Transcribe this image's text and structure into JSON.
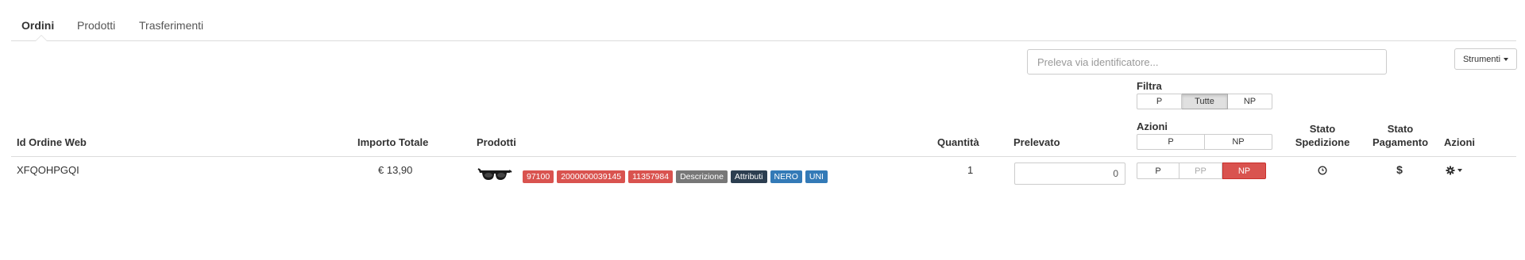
{
  "tabs": [
    {
      "label": "Ordini",
      "active": true
    },
    {
      "label": "Prodotti",
      "active": false
    },
    {
      "label": "Trasferimenti",
      "active": false
    }
  ],
  "search": {
    "placeholder": "Preleva via identificatore..."
  },
  "tools": {
    "label": "Strumenti"
  },
  "filter": {
    "label": "Filtra",
    "options": [
      "P",
      "Tutte",
      "NP"
    ],
    "selected": "Tutte"
  },
  "bulk_actions": {
    "label": "Azioni",
    "options": [
      "P",
      "NP"
    ]
  },
  "columns": {
    "order_id": "Id Ordine Web",
    "total": "Importo Totale",
    "products": "Prodotti",
    "quantity": "Quantità",
    "picked": "Prelevato",
    "actions": "Azioni",
    "shipping_status": [
      "Stato",
      "Spedizione"
    ],
    "payment_status": [
      "Stato",
      "Pagamento"
    ],
    "row_actions": "Azioni"
  },
  "rows": [
    {
      "order_id": "XFQOHPGQI",
      "total": "€ 13,90",
      "product_image": "sunglasses",
      "tags": [
        {
          "text": "97100",
          "color": "#d9534f"
        },
        {
          "text": "2000000039145",
          "color": "#d9534f"
        },
        {
          "text": "11357984",
          "color": "#d9534f"
        },
        {
          "text": "Descrizione",
          "color": "#777777"
        },
        {
          "text": "Attributi",
          "color": "#2c3e50"
        },
        {
          "text": "NERO",
          "color": "#337ab7"
        },
        {
          "text": "UNI",
          "color": "#337ab7"
        }
      ],
      "quantity": "1",
      "picked": "0",
      "pick_buttons": [
        {
          "label": "P",
          "state": "default"
        },
        {
          "label": "PP",
          "state": "muted"
        },
        {
          "label": "NP",
          "state": "danger"
        }
      ],
      "shipping_icon": "clock-icon",
      "payment_icon": "dollar-icon",
      "row_menu_icon": "gear-icon"
    }
  ]
}
